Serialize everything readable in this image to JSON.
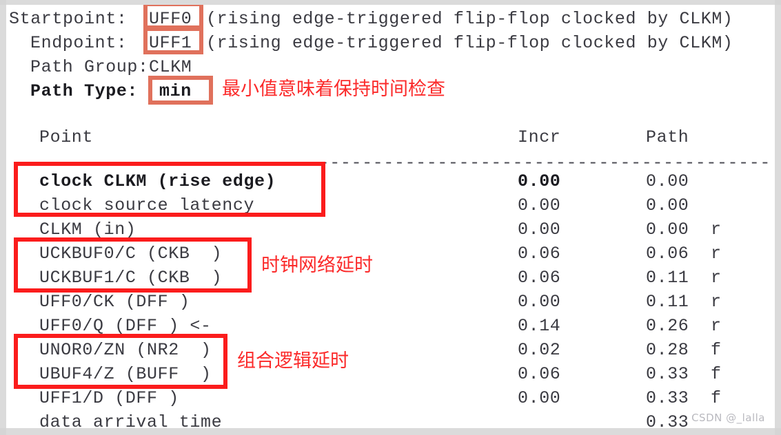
{
  "report": {
    "header": [
      {
        "label": "Startpoint:",
        "value": "UFF0",
        "suffix": "(rising edge-triggered flip-flop clocked by CLKM)"
      },
      {
        "label": "Endpoint:",
        "value": "UFF1",
        "suffix": "(rising edge-triggered flip-flop clocked by CLKM)"
      },
      {
        "label": "Path Group:",
        "value": "CLKM",
        "suffix": ""
      },
      {
        "label": "Path Type:",
        "value": "min",
        "suffix": ""
      }
    ],
    "header_lines": [
      "Startpoint: UFF0 (rising edge-triggered flip-flop clocked by CLKM)",
      "  Endpoint: UFF1 (rising edge-triggered flip-flop clocked by CLKM)",
      "  Path Group: CLKM",
      "  Path Type: min"
    ],
    "columns": {
      "point": "Point",
      "incr": "Incr",
      "path": "Path"
    },
    "separator": "-------------------------------------------------------------------------",
    "rows": [
      {
        "point": "clock CLKM (rise edge)",
        "incr": "0.00",
        "path": "0.00",
        "edge": "",
        "bold": true
      },
      {
        "point": "clock source latency",
        "incr": "0.00",
        "path": "0.00",
        "edge": "",
        "bold": false
      },
      {
        "point": "CLKM (in)",
        "incr": "0.00",
        "path": "0.00",
        "edge": "r",
        "bold": false
      },
      {
        "point": "UCKBUF0/C (CKB  )",
        "incr": "0.06",
        "path": "0.06",
        "edge": "r",
        "bold": false
      },
      {
        "point": "UCKBUF1/C (CKB  )",
        "incr": "0.06",
        "path": "0.11",
        "edge": "r",
        "bold": false
      },
      {
        "point": "UFF0/CK (DFF )",
        "incr": "0.00",
        "path": "0.11",
        "edge": "r",
        "bold": false
      },
      {
        "point": "UFF0/Q (DFF ) <-",
        "incr": "0.14",
        "path": "0.26",
        "edge": "r",
        "bold": false
      },
      {
        "point": "UNOR0/ZN (NR2  )",
        "incr": "0.02",
        "path": "0.28",
        "edge": "f",
        "bold": false
      },
      {
        "point": "UBUF4/Z (BUFF  )",
        "incr": "0.06",
        "path": "0.33",
        "edge": "f",
        "bold": false
      },
      {
        "point": "UFF1/D (DFF )",
        "incr": "0.00",
        "path": "0.33",
        "edge": "f",
        "bold": false
      },
      {
        "point": "data arrival time",
        "incr": "",
        "path": "0.33",
        "edge": "",
        "bold": false
      }
    ]
  },
  "annotations": {
    "notes": [
      {
        "text": "最小值意味着保持时间检查",
        "meaning": "minimum value means hold time check"
      },
      {
        "text": "时钟网络延时",
        "meaning": "clock network delay"
      },
      {
        "text": "组合逻辑延时",
        "meaning": "combinational logic delay"
      }
    ],
    "boxes": [
      {
        "name": "startpoint-value",
        "target": "UFF0"
      },
      {
        "name": "endpoint-value",
        "target": "UFF1"
      },
      {
        "name": "path-type-value",
        "target": "min"
      },
      {
        "name": "clock-source-group",
        "target": "clock CLKM (rise edge) / clock source latency"
      },
      {
        "name": "clock-network-group",
        "target": "UCKBUF0/C / UCKBUF1/C"
      },
      {
        "name": "comb-logic-group",
        "target": "UNOR0/ZN / UBUF4/Z"
      }
    ]
  },
  "colors": {
    "annotation_red": "#fb1c1c",
    "annotation_salmon": "#e0715c",
    "text": "#3b3b42",
    "page_background": "#ffffff"
  },
  "watermark": {
    "text": "CSDN @_lalla"
  }
}
